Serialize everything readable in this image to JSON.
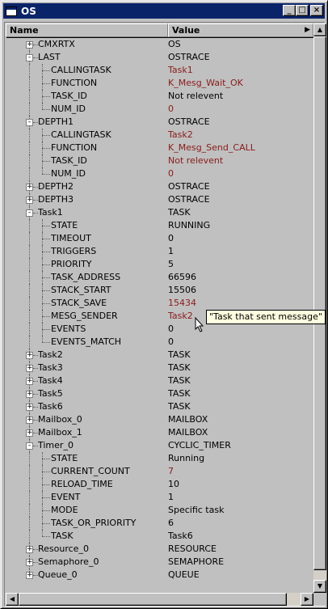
{
  "window": {
    "title": "OS",
    "buttons": {
      "minimize": "_",
      "maximize": "□",
      "close": "×"
    }
  },
  "columns": {
    "name": "Name",
    "value": "Value"
  },
  "tooltip": "\"Task that sent message\"",
  "colors": {
    "titlebar": "#0a246a",
    "highlight_value": "#8b1a1a",
    "tooltip_bg": "#ffffe1"
  },
  "rows": [
    {
      "name": "CMXRTX",
      "value": "OS",
      "level": 0,
      "expander": "+",
      "red": false
    },
    {
      "name": "LAST",
      "value": "OSTRACE",
      "level": 0,
      "expander": "-",
      "red": false
    },
    {
      "name": "CALLINGTASK",
      "value": "Task1",
      "level": 1,
      "expander": "",
      "red": true
    },
    {
      "name": "FUNCTION",
      "value": "K_Mesg_Wait_OK",
      "level": 1,
      "expander": "",
      "red": true
    },
    {
      "name": "TASK_ID",
      "value": "Not relevent",
      "level": 1,
      "expander": "",
      "red": false
    },
    {
      "name": "NUM_ID",
      "value": "0",
      "level": 1,
      "expander": "",
      "red": true
    },
    {
      "name": "DEPTH1",
      "value": "OSTRACE",
      "level": 0,
      "expander": "-",
      "red": false
    },
    {
      "name": "CALLINGTASK",
      "value": "Task2",
      "level": 1,
      "expander": "",
      "red": true
    },
    {
      "name": "FUNCTION",
      "value": "K_Mesg_Send_CALL",
      "level": 1,
      "expander": "",
      "red": true
    },
    {
      "name": "TASK_ID",
      "value": "Not relevent",
      "level": 1,
      "expander": "",
      "red": true
    },
    {
      "name": "NUM_ID",
      "value": "0",
      "level": 1,
      "expander": "",
      "red": true
    },
    {
      "name": "DEPTH2",
      "value": "OSTRACE",
      "level": 0,
      "expander": "+",
      "red": false
    },
    {
      "name": "DEPTH3",
      "value": "OSTRACE",
      "level": 0,
      "expander": "+",
      "red": false
    },
    {
      "name": "Task1",
      "value": "TASK",
      "level": 0,
      "expander": "-",
      "red": false
    },
    {
      "name": "STATE",
      "value": "RUNNING",
      "level": 1,
      "expander": "",
      "red": false
    },
    {
      "name": "TIMEOUT",
      "value": "0",
      "level": 1,
      "expander": "",
      "red": false
    },
    {
      "name": "TRIGGERS",
      "value": "1",
      "level": 1,
      "expander": "",
      "red": false
    },
    {
      "name": "PRIORITY",
      "value": "5",
      "level": 1,
      "expander": "",
      "red": false
    },
    {
      "name": "TASK_ADDRESS",
      "value": "66596",
      "level": 1,
      "expander": "",
      "red": false
    },
    {
      "name": "STACK_START",
      "value": "15506",
      "level": 1,
      "expander": "",
      "red": false
    },
    {
      "name": "STACK_SAVE",
      "value": "15434",
      "level": 1,
      "expander": "",
      "red": true
    },
    {
      "name": "MESG_SENDER",
      "value": "Task2",
      "level": 1,
      "expander": "",
      "red": true
    },
    {
      "name": "EVENTS",
      "value": "0",
      "level": 1,
      "expander": "",
      "red": false
    },
    {
      "name": "EVENTS_MATCH",
      "value": "0",
      "level": 1,
      "expander": "",
      "red": false
    },
    {
      "name": "Task2",
      "value": "TASK",
      "level": 0,
      "expander": "+",
      "red": false
    },
    {
      "name": "Task3",
      "value": "TASK",
      "level": 0,
      "expander": "+",
      "red": false
    },
    {
      "name": "Task4",
      "value": "TASK",
      "level": 0,
      "expander": "+",
      "red": false
    },
    {
      "name": "Task5",
      "value": "TASK",
      "level": 0,
      "expander": "+",
      "red": false
    },
    {
      "name": "Task6",
      "value": "TASK",
      "level": 0,
      "expander": "+",
      "red": false
    },
    {
      "name": "Mailbox_0",
      "value": "MAILBOX",
      "level": 0,
      "expander": "+",
      "red": false
    },
    {
      "name": "Mailbox_1",
      "value": "MAILBOX",
      "level": 0,
      "expander": "+",
      "red": false
    },
    {
      "name": "Timer_0",
      "value": "CYCLIC_TIMER",
      "level": 0,
      "expander": "-",
      "red": false
    },
    {
      "name": "STATE",
      "value": "Running",
      "level": 1,
      "expander": "",
      "red": false
    },
    {
      "name": "CURRENT_COUNT",
      "value": "7",
      "level": 1,
      "expander": "",
      "red": true
    },
    {
      "name": "RELOAD_TIME",
      "value": "10",
      "level": 1,
      "expander": "",
      "red": false
    },
    {
      "name": "EVENT",
      "value": "1",
      "level": 1,
      "expander": "",
      "red": false
    },
    {
      "name": "MODE",
      "value": "Specific task",
      "level": 1,
      "expander": "",
      "red": false
    },
    {
      "name": "TASK_OR_PRIORITY",
      "value": "6",
      "level": 1,
      "expander": "",
      "red": false
    },
    {
      "name": "TASK",
      "value": "Task6",
      "level": 1,
      "expander": "",
      "red": false
    },
    {
      "name": "Resource_0",
      "value": "RESOURCE",
      "level": 0,
      "expander": "+",
      "red": false
    },
    {
      "name": "Semaphore_0",
      "value": "SEMAPHORE",
      "level": 0,
      "expander": "+",
      "red": false
    },
    {
      "name": "Queue_0",
      "value": "QUEUE",
      "level": 0,
      "expander": "+",
      "red": false
    }
  ],
  "scrollbars": {
    "up": "▲",
    "down": "▼",
    "left": "◀",
    "right": "▶"
  }
}
